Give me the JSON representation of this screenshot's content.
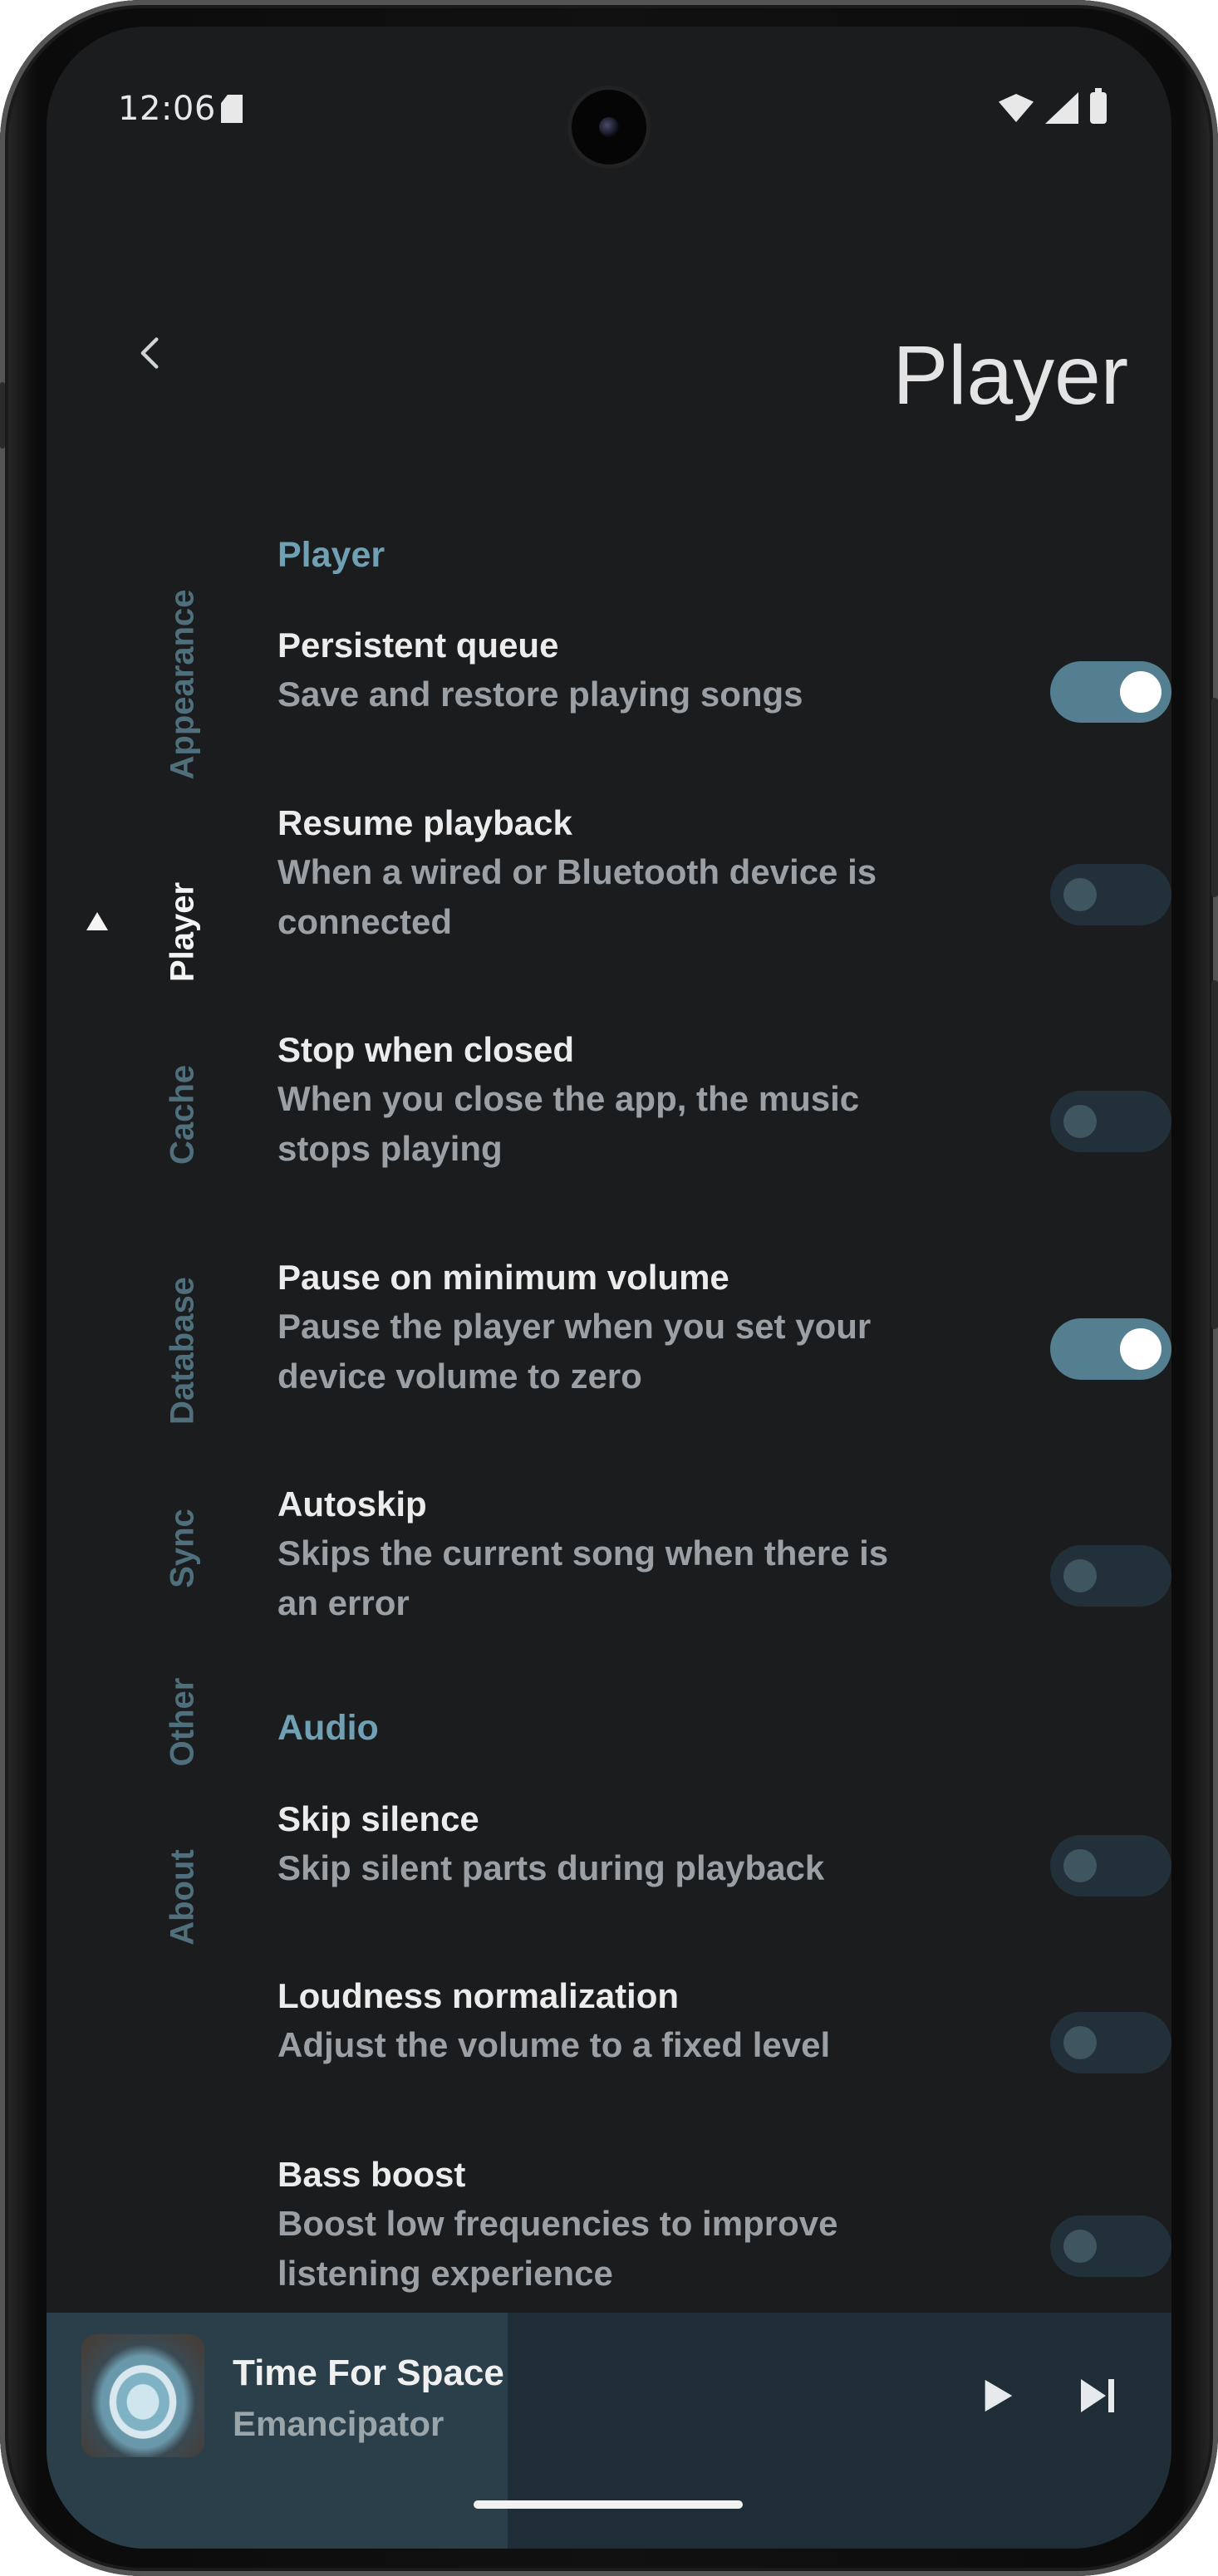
{
  "status_bar": {
    "time": "12:06",
    "icons": [
      "sd-card-icon",
      "wifi-icon",
      "cellular-icon",
      "battery-icon"
    ]
  },
  "header": {
    "back_icon": "chevron-left-icon",
    "title": "Player"
  },
  "nav": {
    "items": [
      {
        "label": "Appearance",
        "active": false
      },
      {
        "label": "Player",
        "active": true
      },
      {
        "label": "Cache",
        "active": false
      },
      {
        "label": "Database",
        "active": false
      },
      {
        "label": "Sync",
        "active": false
      },
      {
        "label": "Other",
        "active": false
      },
      {
        "label": "About",
        "active": false
      }
    ]
  },
  "sections": [
    {
      "title": "Player",
      "settings": [
        {
          "title": "Persistent queue",
          "description": "Save and restore playing songs",
          "enabled": true
        },
        {
          "title": "Resume playback",
          "description": "When a wired or Bluetooth device is connected",
          "enabled": false
        },
        {
          "title": "Stop when closed",
          "description": "When you close the app, the music stops playing",
          "enabled": false
        },
        {
          "title": "Pause on minimum volume",
          "description": "Pause the player when you set your device volume to zero",
          "enabled": true
        },
        {
          "title": "Autoskip",
          "description": "Skips the current song when there is an error",
          "enabled": false
        }
      ]
    },
    {
      "title": "Audio",
      "settings": [
        {
          "title": "Skip silence",
          "description": "Skip silent parts during playback",
          "enabled": false
        },
        {
          "title": "Loudness normalization",
          "description": "Adjust the volume to a fixed level",
          "enabled": false
        },
        {
          "title": "Bass boost",
          "description": "Boost low frequencies to improve listening experience",
          "enabled": false
        }
      ]
    }
  ],
  "mini_player": {
    "track_title": "Time For Space",
    "artist": "Emancipator",
    "progress": 0.41,
    "play_icon": "play-icon",
    "next_icon": "skip-next-icon"
  },
  "colors": {
    "background": "#1a1c1e",
    "accent": "#6fa0b3",
    "toggle_on": "#537f91",
    "toggle_off": "#22303a",
    "nav_inactive": "#4f6f7c"
  }
}
